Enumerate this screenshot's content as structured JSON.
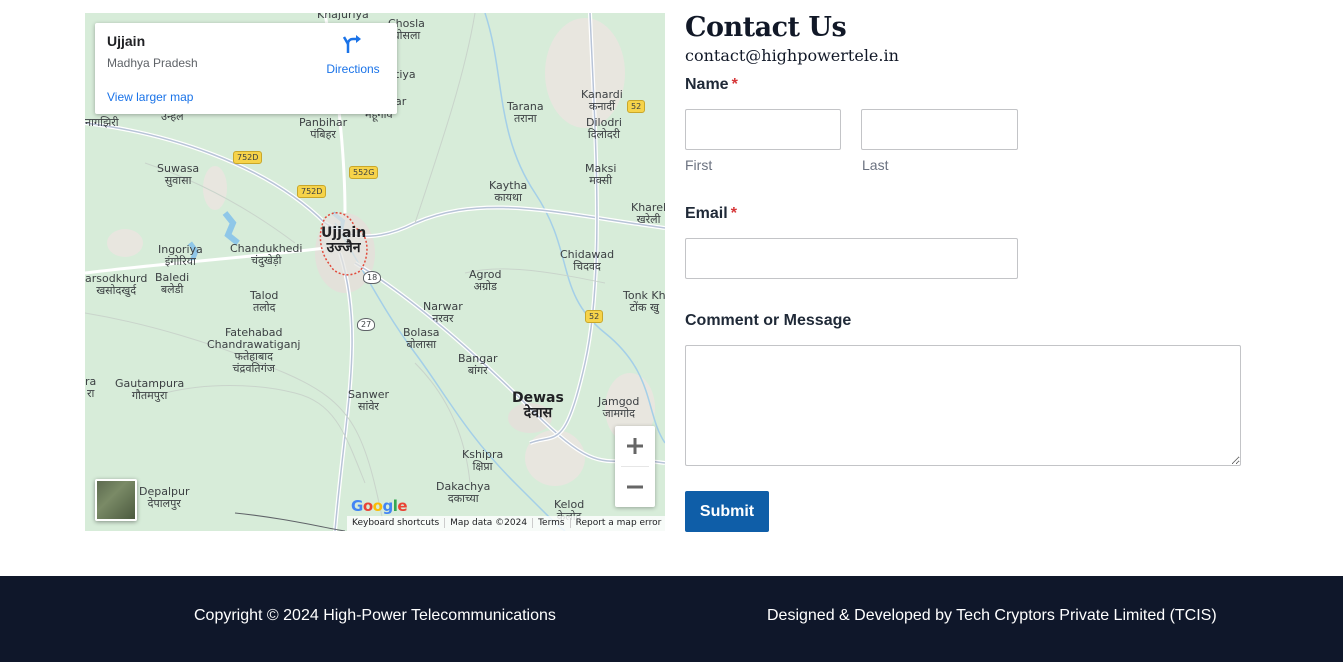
{
  "map": {
    "info": {
      "place": "Ujjain",
      "region": "Madhya Pradesh",
      "directions_label": "Directions",
      "larger_map_label": "View larger map"
    },
    "labels": {
      "khajuriya": "Khajuriya",
      "chosla": "Chosla\nचोसला",
      "tiya": "tiya",
      "ar": "ar",
      "nagzhiri": "नागझिरी",
      "ujhal": "उन्हेल",
      "panbihar": "Panbihar\nपंबिहर",
      "mohgoon": "महूगांव",
      "tarana": "Tarana\nतराना",
      "kanardi": "Kanardi\nकनार्दी",
      "dilodri": "Dilodri\nदिलोदरी",
      "suwasa": "Suwasa\nसुवासा",
      "maksi": "Maksi\nमक्सी",
      "kaytha": "Kaytha\nकायथा",
      "kharel": "Kharel\nखरेली",
      "ingoriya": "Ingoriya\nइंगोरिया",
      "chandukhedi": "Chandukhedi\nचंदुखेड़ी",
      "ujjain": "Ujjain\nउज्जैन",
      "chidawad": "Chidawad\nचिदवद",
      "sarsodkhurd": "arsodkhurd\nखसोदखुर्द",
      "baledi": "Baledi\nबलेडी",
      "agrod": "Agrod\nअग्रोड",
      "talod": "Talod\nतलोद",
      "tonkkh": "Tonk Kh\nटोंक खु",
      "narwar": "Narwar\nनरवर",
      "fatehabad": "Fatehabad\nChandrawatiganj\nफतेहाबाद\nचंद्रवतिगंज",
      "bolasa": "Bolasa\nबोलासा",
      "bangar": "Bangar\nबांगर",
      "gautampura": "Gautampura\nगौतमपुरा",
      "ra": "ra\nरा",
      "sanwer": "Sanwer\nसांवेर",
      "dewas": "Dewas\nदेवास",
      "jamgod": "Jamgod\nजामगोद",
      "kshipra": "Kshipra\nक्षिप्रा",
      "dakachya": "Dakachya\nदकाच्या",
      "depalpur": "Depalpur\nदेपालपुर",
      "kelod": "Kelod\nकेलोद"
    },
    "shields": {
      "s752d_a": "752D",
      "s752d_b": "752D",
      "s552g": "552G",
      "s52_a": "52",
      "s52_b": "52",
      "s18": "18",
      "s27": "27"
    },
    "google_logo": "Google",
    "attribution": {
      "shortcuts": "Keyboard shortcuts",
      "data": "Map data ©2024",
      "terms": "Terms",
      "report": "Report a map error"
    }
  },
  "contact": {
    "title": "Contact Us",
    "email": "contact@highpowertele.in",
    "name_label": "Name",
    "first_label": "First",
    "last_label": "Last",
    "email_label": "Email",
    "message_label": "Comment or Message",
    "required_mark": "*",
    "submit_label": "Submit",
    "first_value": "",
    "last_value": "",
    "email_value": "",
    "message_value": ""
  },
  "footer": {
    "copyright": "Copyright © 2024 High-Power Telecommunications",
    "credit": "Designed & Developed by Tech Cryptors Private Limited (TCIS)"
  }
}
